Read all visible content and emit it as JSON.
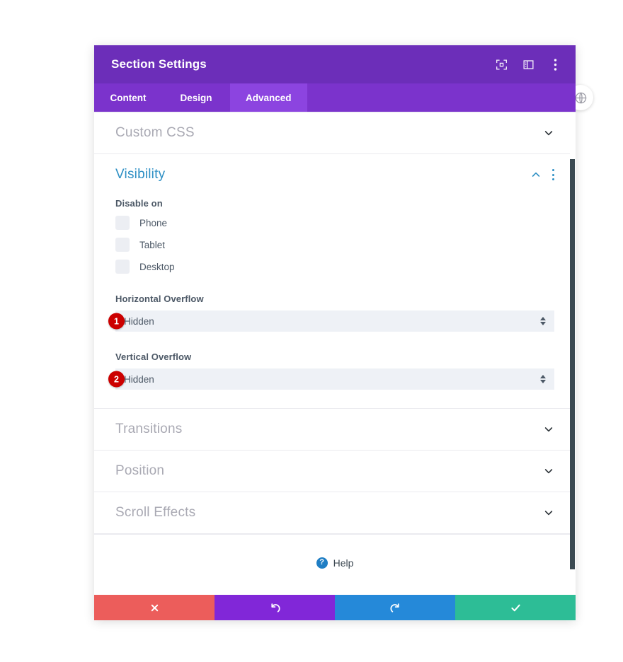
{
  "window": {
    "title": "Section Settings"
  },
  "header": {
    "icons": [
      {
        "name": "fullscreen-icon",
        "label": "Fullscreen"
      },
      {
        "name": "layout-panel-icon",
        "label": "Panel Layout"
      },
      {
        "name": "more-options-icon",
        "label": "More Options"
      }
    ]
  },
  "tabs": [
    {
      "label": "Content",
      "active": false
    },
    {
      "label": "Design",
      "active": false
    },
    {
      "label": "Advanced",
      "active": true
    }
  ],
  "sections": {
    "custom_css": {
      "title": "Custom CSS",
      "state": "collapsed"
    },
    "visibility": {
      "title": "Visibility",
      "state": "expanded"
    },
    "transitions": {
      "title": "Transitions",
      "state": "collapsed"
    },
    "position": {
      "title": "Position",
      "state": "collapsed"
    },
    "scroll_effects": {
      "title": "Scroll Effects",
      "state": "collapsed"
    }
  },
  "visibility": {
    "disable_on_label": "Disable on",
    "devices": [
      {
        "label": "Phone",
        "checked": false
      },
      {
        "label": "Tablet",
        "checked": false
      },
      {
        "label": "Desktop",
        "checked": false
      }
    ],
    "horizontal_overflow": {
      "label": "Horizontal Overflow",
      "value": "Hidden",
      "badge": "1"
    },
    "vertical_overflow": {
      "label": "Vertical Overflow",
      "value": "Hidden",
      "badge": "2"
    }
  },
  "help": {
    "label": "Help",
    "icon_glyph": "?"
  },
  "footer": {
    "buttons": [
      {
        "name": "cancel-button",
        "glyph": "close-icon",
        "color": "#ec5d5b"
      },
      {
        "name": "undo-button",
        "glyph": "undo-icon",
        "color": "#8127d8"
      },
      {
        "name": "redo-button",
        "glyph": "redo-icon",
        "color": "#2589d9"
      },
      {
        "name": "save-button",
        "glyph": "check-icon",
        "color": "#2dbd96"
      }
    ]
  },
  "floating": {
    "globe_label": "Globe"
  },
  "colors": {
    "header_purple": "#6c2eb9",
    "tabbar_purple": "#7b33cc",
    "active_tab_purple": "#8c44e0",
    "section_title_muted": "#a9a9b3",
    "section_title_active": "#2d8fc4",
    "badge_red": "#cc0000",
    "field_bg": "#eef1f6"
  }
}
